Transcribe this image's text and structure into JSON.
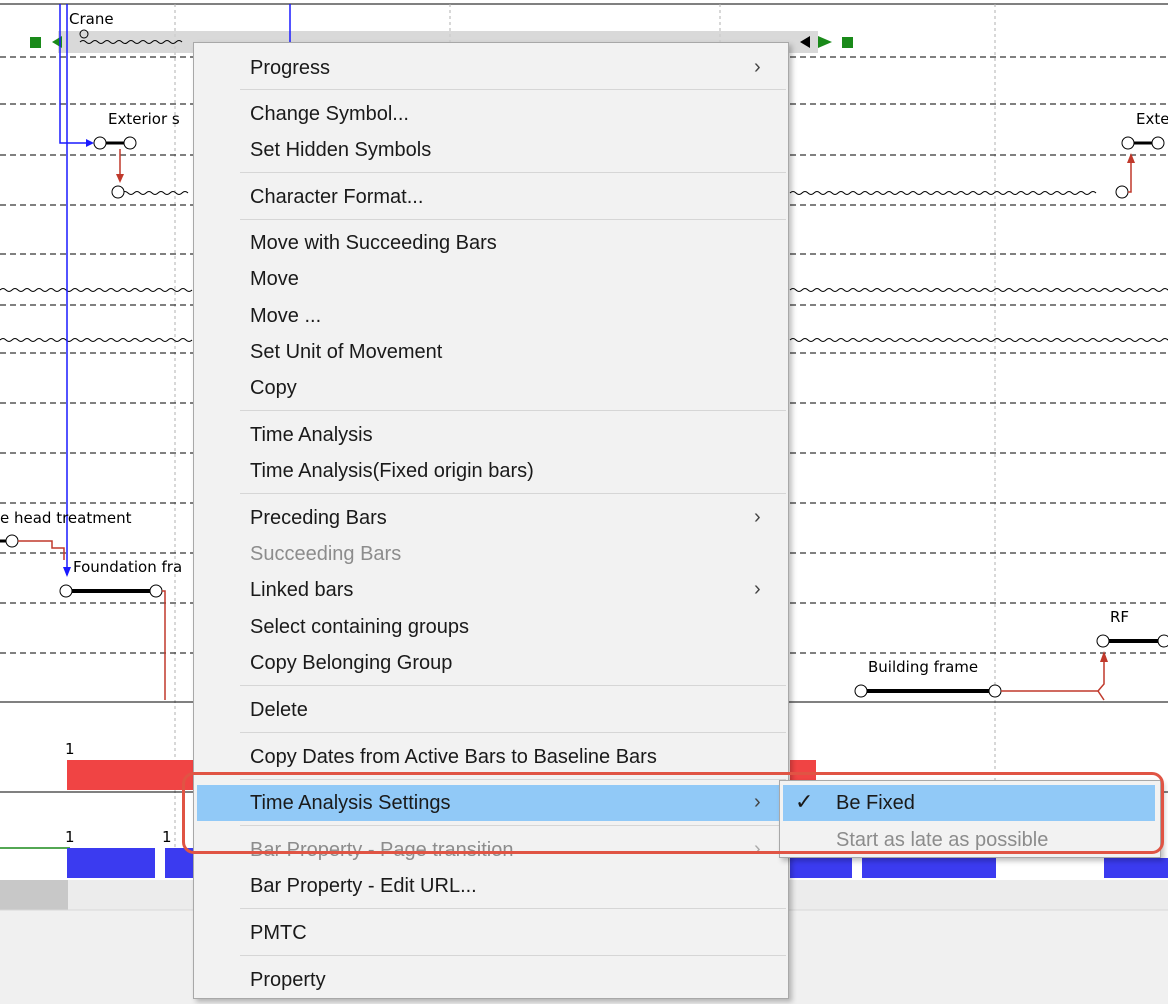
{
  "gantt": {
    "labels": {
      "crane": "Crane",
      "exterior_left": "Exterior s",
      "exterior_right": "Exte",
      "head_treatment": "e head treatment",
      "foundation": "Foundation fra",
      "rf": "RF",
      "building_frame": "Building frame",
      "band1_count": "1",
      "band2_count_a": "1",
      "band2_count_b": "1"
    },
    "colors": {
      "red_bar": "#f04444",
      "blue_bar": "#3b3bf0",
      "milestone_green": "#1a8a1a",
      "link_blue": "#1a1aff",
      "link_red": "#c0392b"
    }
  },
  "context_menu": {
    "items": [
      {
        "label": "Progress",
        "submenu": true
      },
      {
        "label": "Change Symbol..."
      },
      {
        "label": "Set Hidden Symbols"
      },
      {
        "label": "Character Format..."
      },
      {
        "label": "Move with Succeeding Bars"
      },
      {
        "label": "Move"
      },
      {
        "label": "Move ..."
      },
      {
        "label": "Set Unit of Movement"
      },
      {
        "label": "Copy"
      },
      {
        "label": "Time Analysis"
      },
      {
        "label": "Time Analysis(Fixed origin bars)"
      },
      {
        "label": "Preceding Bars",
        "submenu": true
      },
      {
        "label": "Succeeding Bars",
        "disabled": true
      },
      {
        "label": "Linked bars",
        "submenu": true
      },
      {
        "label": "Select containing groups"
      },
      {
        "label": "Copy Belonging Group"
      },
      {
        "label": "Delete"
      },
      {
        "label": "Copy Dates from Active Bars to Baseline Bars"
      },
      {
        "label": "Time Analysis Settings",
        "submenu": true,
        "highlighted": true
      },
      {
        "label": "Bar Property - Page transition",
        "submenu": true,
        "disabled": true
      },
      {
        "label": "Bar Property - Edit URL..."
      },
      {
        "label": "PMTC"
      },
      {
        "label": "Property"
      }
    ],
    "submenu_arrow": "›"
  },
  "time_analysis_submenu": {
    "items": [
      {
        "label": "Be Fixed",
        "checked": true,
        "highlighted": true
      },
      {
        "label": "Start as late as possible",
        "disabled": true
      }
    ],
    "check_glyph": "✓"
  },
  "highlight_color": "#91c9f7",
  "callout_color": "#e05444"
}
